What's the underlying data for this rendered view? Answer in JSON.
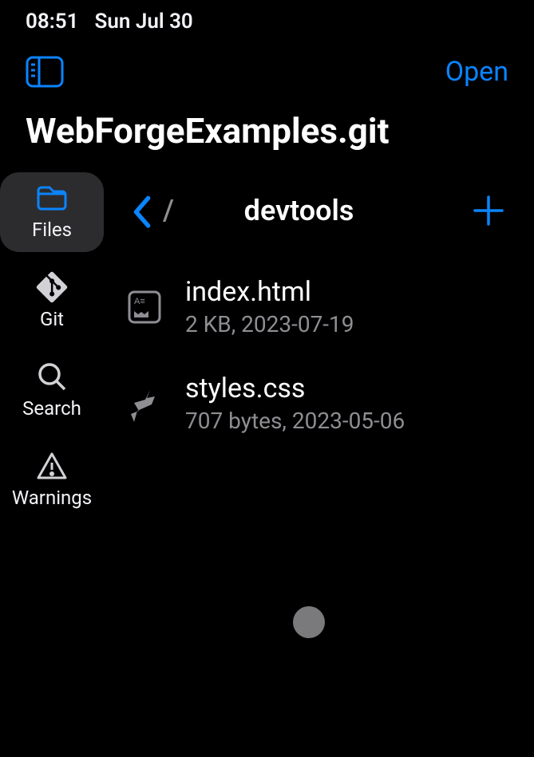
{
  "status": {
    "time": "08:51",
    "date": "Sun Jul 30"
  },
  "header": {
    "open_label": "Open"
  },
  "title": "WebForgeExamples.git",
  "sidebar": {
    "items": [
      {
        "label": "Files"
      },
      {
        "label": "Git"
      },
      {
        "label": "Search"
      },
      {
        "label": "Warnings"
      }
    ]
  },
  "path": {
    "slash": "/",
    "current": "devtools"
  },
  "files": [
    {
      "name": "index.html",
      "meta": "2 KB, 2023-07-19"
    },
    {
      "name": "styles.css",
      "meta": "707 bytes, 2023-05-06"
    }
  ]
}
